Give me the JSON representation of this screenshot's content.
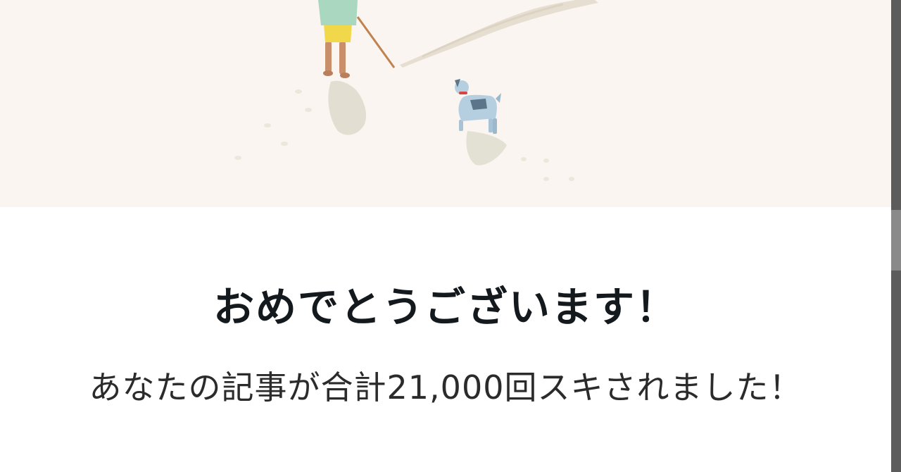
{
  "dialog": {
    "illustration": "person-walking-dog-on-beach",
    "title": "おめでとうございます！",
    "message": "あなたの記事が合計21,000回スキされました！"
  },
  "colors": {
    "hero_background": "#faf5f0",
    "title_text": "#14191d",
    "message_text": "#2b2b2b"
  }
}
